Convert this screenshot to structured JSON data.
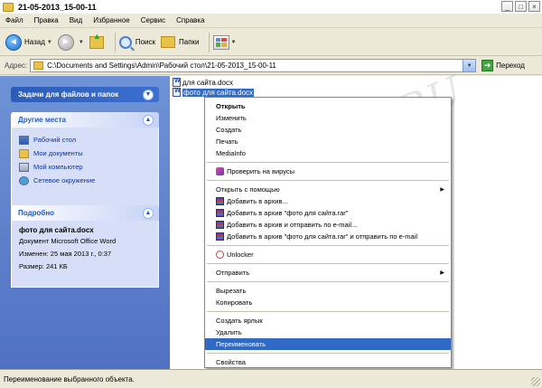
{
  "window": {
    "title": "21-05-2013_15-00-11",
    "controls": [
      "_",
      "□",
      "×"
    ]
  },
  "menubar": [
    "Файл",
    "Правка",
    "Вид",
    "Избранное",
    "Сервис",
    "Справка"
  ],
  "toolbar": {
    "back": "Назад",
    "search": "Поиск",
    "folders": "Папки"
  },
  "address": {
    "label": "Адрес:",
    "path": "C:\\Documents and Settings\\Admin\\Рабочий стол\\21-05-2013_15-00-11",
    "go": "Переход"
  },
  "left": {
    "tasks_title": "Задачи для файлов и папок",
    "places_title": "Другие места",
    "places": [
      "Рабочий стол",
      "Мои документы",
      "Мой компьютер",
      "Сетевое окружение"
    ],
    "details_title": "Подробно",
    "details": {
      "name": "фото для сайта.docx",
      "type": "Документ Microsoft Office Word",
      "modified": "Изменен: 25 мая 2013 г., 0:37",
      "size": "Размер: 241 КБ"
    }
  },
  "files": [
    "для сайта.docx",
    "фото для сайта.docx"
  ],
  "watermark": "All4OS.RU",
  "context_menu": {
    "g1": [
      "Открыть",
      "Изменить",
      "Создать",
      "Печать",
      "MediaInfo"
    ],
    "g2": [
      "Проверить на вирусы"
    ],
    "g3": [
      "Открыть с помощью",
      "Добавить в архив...",
      "Добавить в архив \"фото для сайта.rar\"",
      "Добавить в архив и отправить по e-mail...",
      "Добавить в архив \"фото для сайта.rar\" и отправить по e-mail"
    ],
    "g4": [
      "Unlocker"
    ],
    "g5": [
      "Отправить"
    ],
    "g6": [
      "Вырезать",
      "Копировать"
    ],
    "g7": [
      "Создать ярлык",
      "Удалить",
      "Переименовать"
    ],
    "g8": [
      "Свойства"
    ]
  },
  "status": "Переименование выбранного объекта.",
  "colors": {
    "selection": "#316ac5",
    "task_pane": "#6f93d6",
    "link": "#0c32a6"
  }
}
